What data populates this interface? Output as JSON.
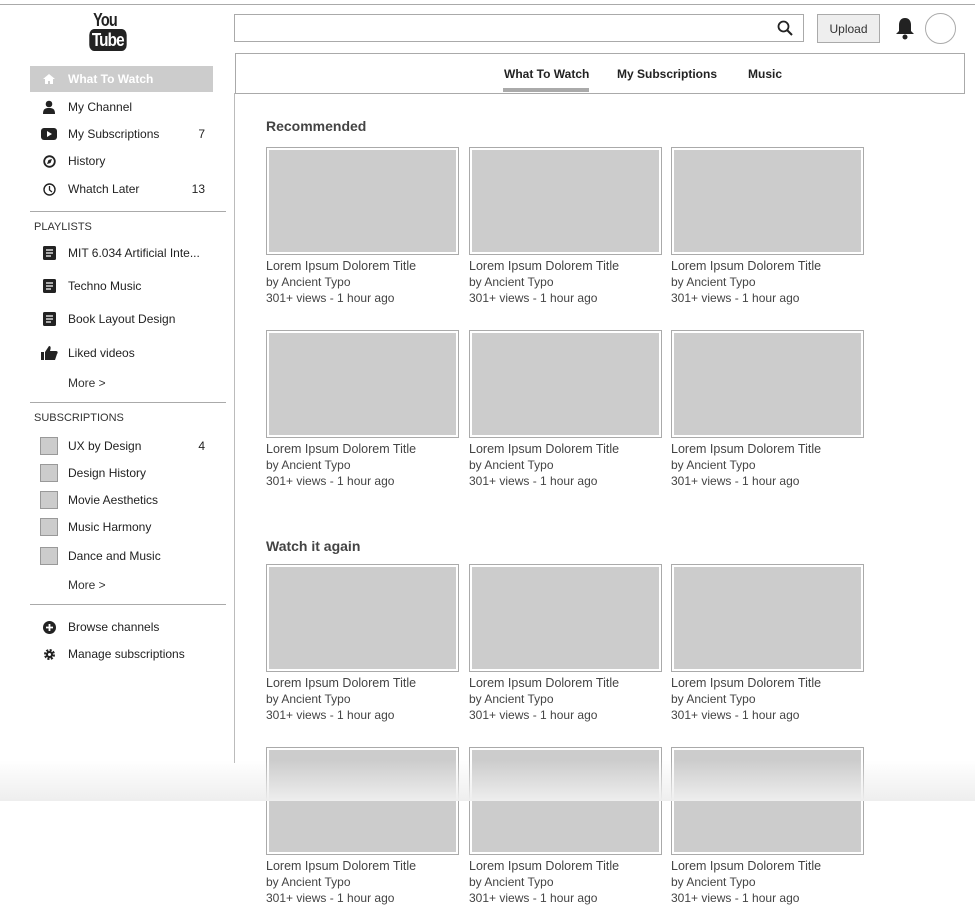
{
  "logo": {
    "line1": "You",
    "line2": "Tube"
  },
  "sidebar": {
    "nav": [
      {
        "label": "What To Watch",
        "icon": "home-icon"
      },
      {
        "label": "My Channel",
        "icon": "user-icon"
      },
      {
        "label": "My Subscriptions",
        "count": "7",
        "icon": "play-icon"
      },
      {
        "label": "History",
        "icon": "compass-icon"
      },
      {
        "label": "Whatch Later",
        "count": "13",
        "icon": "clock-icon"
      }
    ],
    "playlists_title": "PLAYLISTS",
    "playlists": [
      {
        "label": "MIT 6.034 Artificial Inte...",
        "icon": "list-icon"
      },
      {
        "label": "Techno Music",
        "icon": "list-icon"
      },
      {
        "label": "Book Layout Design",
        "icon": "list-icon"
      },
      {
        "label": "Liked videos",
        "icon": "thumbs-up-icon"
      }
    ],
    "more": "More >",
    "subscriptions_title": "SUBSCRIPTIONS",
    "subscriptions": [
      {
        "label": "UX by Design",
        "count": "4"
      },
      {
        "label": "Design History"
      },
      {
        "label": "Movie Aesthetics"
      },
      {
        "label": "Music Harmony"
      },
      {
        "label": "Dance and Music"
      }
    ],
    "footer": [
      {
        "label": "Browse channels",
        "icon": "plus-circle-icon"
      },
      {
        "label": "Manage subscriptions",
        "icon": "gear-icon"
      }
    ]
  },
  "header": {
    "search_placeholder": "",
    "upload": "Upload"
  },
  "tabs": [
    "What To Watch",
    "My Subscriptions",
    "Music"
  ],
  "sections": [
    {
      "title": "Recommended"
    },
    {
      "title": "Watch it again"
    }
  ],
  "video": {
    "title": "Lorem Ipsum Dolorem Title",
    "channel": "by Ancient Typo",
    "meta": "301+ views - 1 hour ago"
  }
}
